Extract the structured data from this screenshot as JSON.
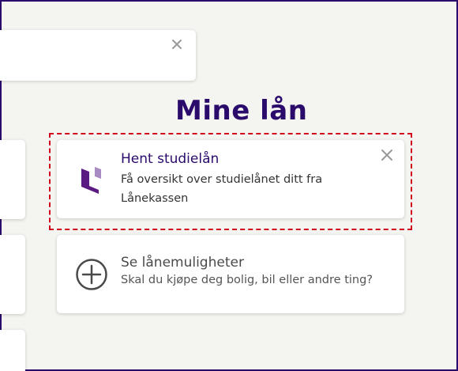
{
  "section": {
    "title": "Mine lån"
  },
  "loan_card": {
    "title": "Hent studielån",
    "description": "Få oversikt over studielånet ditt fra Lånekassen",
    "icon": "lanekassen-logo"
  },
  "options_card": {
    "title": "Se lånemuligheter",
    "description": "Skal du kjøpe deg bolig, bil eller andre ting?",
    "icon": "plus-circle-icon"
  },
  "colors": {
    "brand": "#2a0a6b",
    "focus": "#d0021b",
    "logo_dark": "#5b1a82",
    "logo_light": "#a98bc4"
  }
}
